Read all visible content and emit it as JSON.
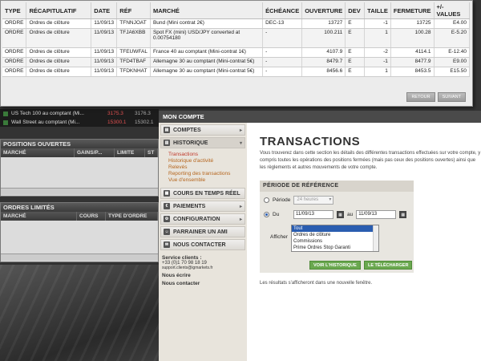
{
  "popup": {
    "columns": [
      "TYPE",
      "RÉCAPITULATIF",
      "DATE",
      "RÉF",
      "MARCHÉ",
      "ÉCHÉANCE",
      "OUVERTURE",
      "DEV",
      "TAILLE",
      "FERMETURE",
      "+/- VALUES"
    ],
    "rows": [
      [
        "ORDRE",
        "Ordres de clôture",
        "11/09/13",
        "TFNNJOAT",
        "Bund (Mini contrat 2€)",
        "DEC-13",
        "13727",
        "E",
        "-1",
        "13725",
        "E4.00"
      ],
      [
        "ORDRE",
        "Ordres de clôture",
        "11/09/13",
        "TFJA6XBB",
        "Spot FX (mini) USD/JPY converted at 0.00754180",
        "-",
        "100.211",
        "E",
        "1",
        "100.28",
        "E-5.20"
      ],
      [
        "ORDRE",
        "Ordres de clôture",
        "11/09/13",
        "TFEUWFAL",
        "France 40 au comptant (Mini-contrat 1€)",
        "-",
        "4107.9",
        "E",
        "-2",
        "4114.1",
        "E-12.40"
      ],
      [
        "ORDRE",
        "Ordres de clôture",
        "11/09/13",
        "TFD4TBAF",
        "Allemagne 30 au comptant (Mini-contrat 5€)",
        "-",
        "8479.7",
        "E",
        "-1",
        "8477.9",
        "E9.00"
      ],
      [
        "ORDRE",
        "Ordres de clôture",
        "11/09/13",
        "TFDKNHAT",
        "Allemagne 30 au comptant (Mini-contrat 5€)",
        "-",
        "8456.6",
        "E",
        "1",
        "8453.5",
        "E15.50"
      ]
    ],
    "btn_retour": "RETOUR",
    "btn_suivant": "SUIVANT"
  },
  "ticker": [
    {
      "name": "US Tech 100 au comptant (Mi...",
      "v1": "3175.3",
      "v2": "3176.3"
    },
    {
      "name": "Wall Street au comptant (Mi...",
      "v1": "15300.1",
      "v2": "15302.1"
    }
  ],
  "positions": {
    "title": "POSITIONS OUVERTES",
    "cols": [
      "MARCHÉ",
      "GAINS/P...",
      "LIMITE",
      "ST"
    ]
  },
  "ordres": {
    "title": "ORDRES LIMITÉS",
    "cols": [
      "MARCHÉ",
      "COURS",
      "TYPE D'ORDRE"
    ]
  },
  "nav": {
    "header": "MON COMPTE",
    "comptes": "COMPTES",
    "historique": "HISTORIQUE",
    "sub": [
      "Transactions",
      "Historique d'activité",
      "Relevés",
      "Reporting des transactions",
      "Vue d'ensemble"
    ],
    "cours": "COURS EN TEMPS RÉEL",
    "paiements": "PAIEMENTS",
    "configuration": "CONFIGURATION",
    "parrainer": "PARRAINER UN AMI",
    "contacter": "NOUS CONTACTER",
    "service_title": "Service clients :",
    "phone": "+33 (0)1 70 98 18 19",
    "email": "support.clients@igmarkets.fr",
    "ecrire": "Nous écrire",
    "contacter_link": "Nous contacter"
  },
  "main": {
    "title": "TRANSACTIONS",
    "intro": "Vous trouverez dans cette section les détails des différentes transactions effectuées sur votre compte, y compris toutes les opérations des positions fermées (mais pas ceux des positions ouvertes) ainsi que les règlements et autres mouvements de votre compte.",
    "period_title": "PÉRIODE DE RÉFÉRENCE",
    "periode_label": "Période",
    "periode_value": "24 heures",
    "du_label": "Du",
    "date_from": "11/09/13",
    "au_label": "au",
    "date_to": "11/09/13",
    "afficher_label": "Afficher",
    "options": [
      "Tout",
      "Ordres de clôture",
      "Commissions",
      "Prime Ordres Stop Garanti"
    ],
    "btn_voir": "VOIR L'HISTORIQUE",
    "btn_telecharger": "LE TÉLÉCHARGER",
    "note": "Les résultats s'afficheront dans une nouvelle fenêtre."
  }
}
